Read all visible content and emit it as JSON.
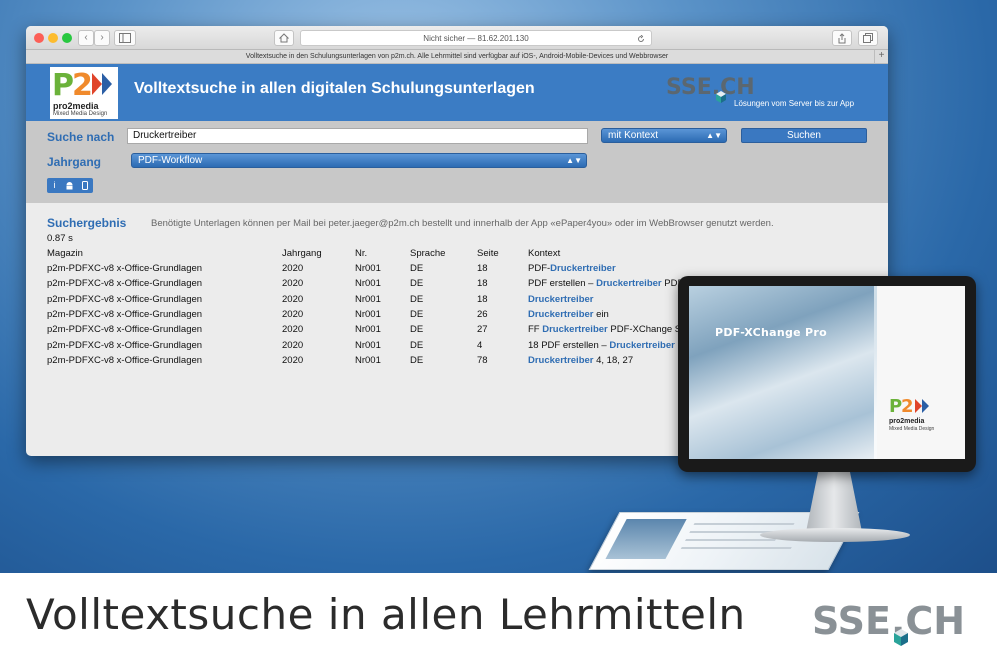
{
  "browser": {
    "url_text": "Nicht sicher — 81.62.201.130",
    "tab_text": "Volltextsuche in den Schulungsunterlagen von p2m.ch. Alle Lehrmittel sind verfügbar auf iOS-, Android-Mobile-Devices und Webbrowser",
    "back": "‹",
    "forward": "›",
    "tab_plus": "+"
  },
  "header": {
    "logo_text": "pro2media",
    "logo_subtext": "Mixed Media Design",
    "title": "Volltextsuche in allen digitalen Schulungsunterlagen",
    "sse_logo": "SSE.CH",
    "tagline": "Lösungen vom Server bis zur App"
  },
  "search": {
    "label_search": "Suche nach",
    "query": "Druckertreiber",
    "context_select": "mit Kontext",
    "search_button": "Suchen",
    "label_year": "Jahrgang",
    "year_select": "PDF-Workflow",
    "device_icons": [
      "info-icon",
      "android-icon",
      "phone-icon"
    ]
  },
  "results": {
    "title": "Suchergebnis",
    "note": "Benötigte Unterlagen können per Mail bei peter.jaeger@p2m.ch bestellt und innerhalb der App «ePaper4you» oder im WebBrowser genutzt werden.",
    "time": "0.87 s",
    "columns": [
      "Magazin",
      "Jahrgang",
      "Nr.",
      "Sprache",
      "Seite",
      "Kontext"
    ],
    "rows": [
      {
        "magazin": "p2m-PDFXC-v8 x-Office-Grundlagen",
        "jahrgang": "2020",
        "nr": "Nr001",
        "sprache": "DE",
        "seite": "18",
        "pre": "PDF-",
        "hit": "Druckertreiber",
        "post": ""
      },
      {
        "magazin": "p2m-PDFXC-v8 x-Office-Grundlagen",
        "jahrgang": "2020",
        "nr": "Nr001",
        "sprache": "DE",
        "seite": "18",
        "pre": "PDF erstellen – ",
        "hit": "Druckertreiber",
        "post": " PDF-XChange Standard"
      },
      {
        "magazin": "p2m-PDFXC-v8 x-Office-Grundlagen",
        "jahrgang": "2020",
        "nr": "Nr001",
        "sprache": "DE",
        "seite": "18",
        "pre": "",
        "hit": "Druckertreiber",
        "post": ""
      },
      {
        "magazin": "p2m-PDFXC-v8 x-Office-Grundlagen",
        "jahrgang": "2020",
        "nr": "Nr001",
        "sprache": "DE",
        "seite": "26",
        "pre": "",
        "hit": "Druckertreiber",
        "post": " ein"
      },
      {
        "magazin": "p2m-PDFXC-v8 x-Office-Grundlagen",
        "jahrgang": "2020",
        "nr": "Nr001",
        "sprache": "DE",
        "seite": "27",
        "pre": "FF ",
        "hit": "Druckertreiber",
        "post": " PDF-XChange S"
      },
      {
        "magazin": "p2m-PDFXC-v8 x-Office-Grundlagen",
        "jahrgang": "2020",
        "nr": "Nr001",
        "sprache": "DE",
        "seite": "4",
        "pre": "18 PDF erstellen – ",
        "hit": "Druckertreiber",
        "post": " P"
      },
      {
        "magazin": "p2m-PDFXC-v8 x-Office-Grundlagen",
        "jahrgang": "2020",
        "nr": "Nr001",
        "sprache": "DE",
        "seite": "78",
        "pre": "",
        "hit": "Druckertreiber",
        "post": " 4, 18, 27"
      }
    ]
  },
  "monitor": {
    "screen_title": "PDF-XChange Pro",
    "screen_logo": "pro2media",
    "screen_logo_sub": "Mixed Media Design"
  },
  "footer": {
    "caption": "Volltextsuche in allen Lehrmitteln",
    "logo": "SSE.CH"
  },
  "colors": {
    "accent": "#3b7cc4",
    "link": "#2f6db3",
    "p2m_red": "#e0442a",
    "p2m_orange": "#f08a2c",
    "p2m_green": "#6bb23a",
    "p2m_blue": "#2b5fa6",
    "sse_grey": "#8a9196",
    "sse_teal": "#2aa39a"
  }
}
